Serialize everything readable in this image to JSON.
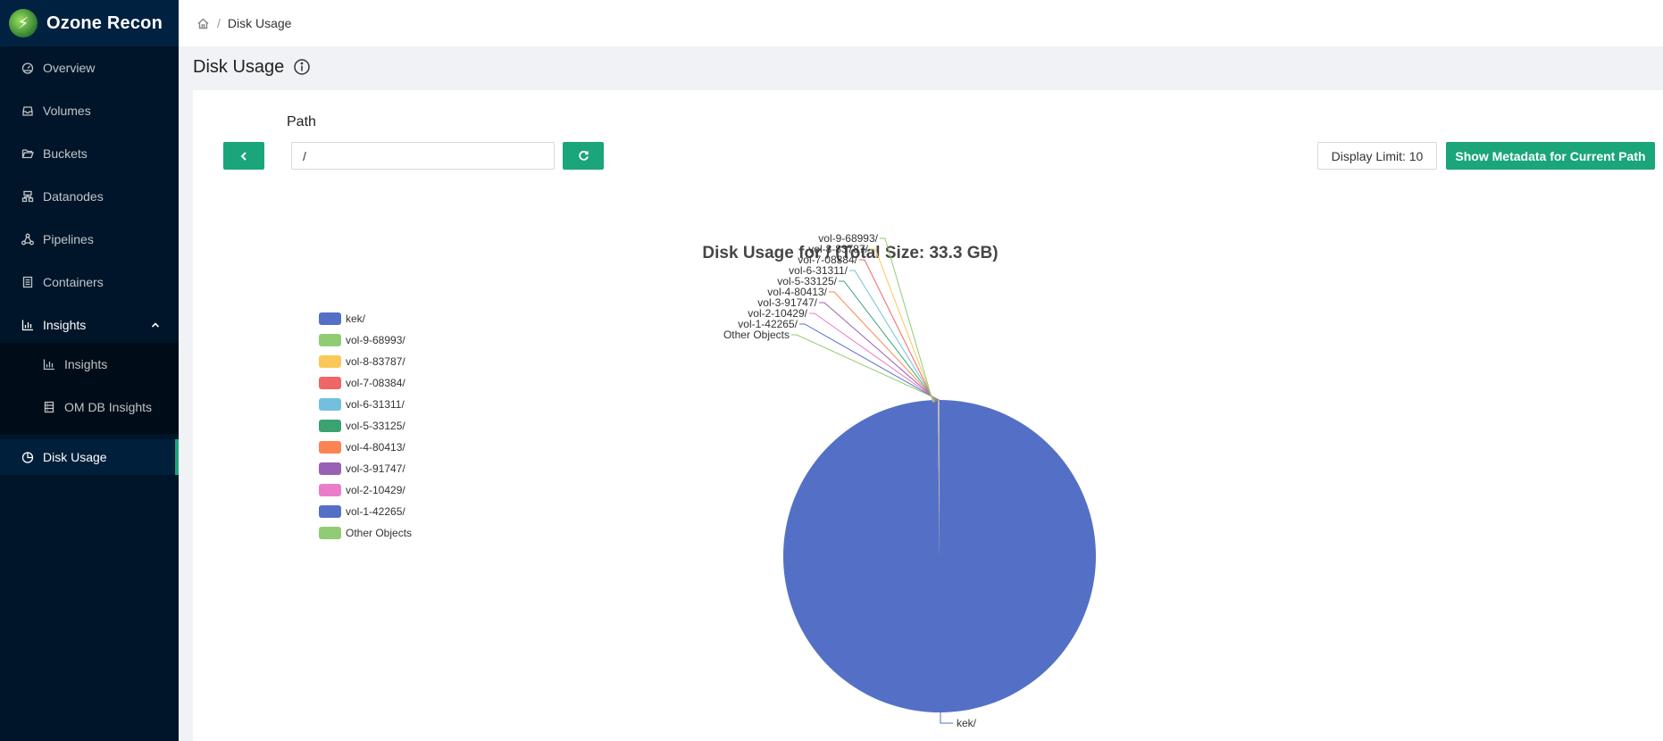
{
  "app": {
    "title": "Ozone Recon",
    "logo_glyph": "⚡"
  },
  "sidebar": {
    "items": [
      {
        "label": "Overview",
        "icon": "dashboard-icon"
      },
      {
        "label": "Volumes",
        "icon": "inbox-icon"
      },
      {
        "label": "Buckets",
        "icon": "folder-open-icon"
      },
      {
        "label": "Datanodes",
        "icon": "cluster-icon"
      },
      {
        "label": "Pipelines",
        "icon": "deployment-unit-icon"
      },
      {
        "label": "Containers",
        "icon": "container-icon"
      },
      {
        "label": "Insights",
        "icon": "bar-chart-icon",
        "expanded": true
      },
      {
        "label": "Insights",
        "icon": "bar-chart-icon",
        "sub": true
      },
      {
        "label": "OM DB Insights",
        "icon": "database-icon",
        "sub": true
      },
      {
        "label": "Disk Usage",
        "icon": "pie-chart-icon",
        "selected": true
      }
    ]
  },
  "breadcrumb": {
    "home_icon": "home-icon",
    "separator": "/",
    "current": "Disk Usage"
  },
  "page": {
    "title": "Disk Usage",
    "info_icon": "info-circle-icon"
  },
  "controls": {
    "path_label": "Path",
    "path_value": "/",
    "back_icon": "chevron-left-icon",
    "refresh_icon": "reload-icon",
    "display_limit_label": "Display Limit: 10",
    "metadata_button_label": "Show Metadata for Current Path",
    "accent_color": "#1aa57a"
  },
  "chart_data": {
    "type": "pie",
    "title": "Disk Usage for / (Total Size: 33.3 GB)",
    "legend_placement": "left",
    "categories": [
      "kek/",
      "vol-9-68993/",
      "vol-8-83787/",
      "vol-7-08384/",
      "vol-6-31311/",
      "vol-5-33125/",
      "vol-4-80413/",
      "vol-3-91747/",
      "vol-2-10429/",
      "vol-1-42265/",
      "Other Objects"
    ],
    "values": [
      33.24,
      0.006,
      0.006,
      0.006,
      0.006,
      0.006,
      0.006,
      0.006,
      0.006,
      0.006,
      0.006
    ],
    "colors": [
      "#5470c6",
      "#91cc75",
      "#fac858",
      "#ee6666",
      "#73c0de",
      "#3ba272",
      "#fc8452",
      "#9a60b4",
      "#ea7ccc",
      "#5470c6",
      "#91cc75"
    ],
    "value_unit": "GB"
  }
}
